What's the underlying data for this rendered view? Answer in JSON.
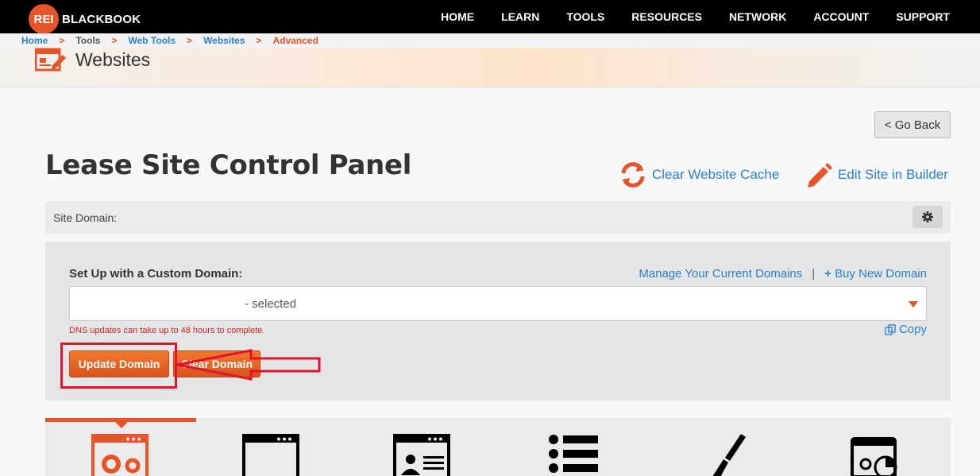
{
  "brand": {
    "logo_mark": "REI",
    "logo_text": "BLACKBOOK"
  },
  "nav": [
    "HOME",
    "LEARN",
    "TOOLS",
    "RESOURCES",
    "NETWORK",
    "ACCOUNT",
    "SUPPORT"
  ],
  "breadcrumb": [
    "Home",
    "Tools",
    "Web Tools",
    "Websites",
    "Advanced"
  ],
  "banner": {
    "title": "Websites"
  },
  "go_back_label": "< Go Back",
  "page_title": "Lease Site Control Panel",
  "actions": {
    "clear_cache": "Clear Website Cache",
    "edit_builder": "Edit Site in Builder"
  },
  "site_domain_label": "Site Domain:",
  "custom_domain": {
    "label": "Set Up with a Custom Domain:",
    "manage_link": "Manage Your Current Domains",
    "divider": "|",
    "buy_link": "Buy New Domain",
    "selected_value": "- selected",
    "dns_note": "DNS updates can take up to 48 hours to complete.",
    "copy_link": "Copy",
    "update_button": "Update Domain",
    "clear_button": "Clear Domain"
  },
  "tab_icons": [
    "site-settings-icon",
    "blank-page-icon",
    "profile-page-icon",
    "list-icon",
    "paintbrush-icon",
    "analytics-icon"
  ],
  "colors": {
    "accent": "#e8542a",
    "link": "#2a7fc9",
    "annotation": "#e0142a"
  }
}
